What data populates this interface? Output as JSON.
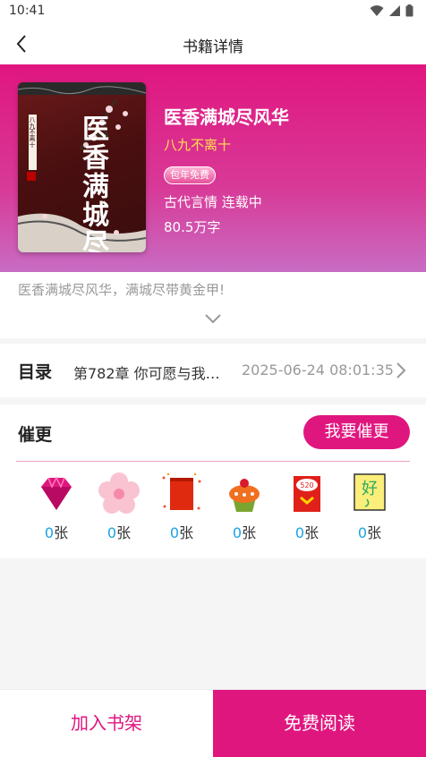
{
  "status_bar": {
    "time": "10:41"
  },
  "nav": {
    "title": "书籍详情"
  },
  "book": {
    "title": "医香满城尽风华",
    "author": "八九不离十",
    "badge": "包年免费",
    "meta": "古代言情 连载中",
    "words": "80.5万字",
    "cover_title_text": "医香满城尽风华",
    "cover_author_text": "八九不离十"
  },
  "intro": {
    "text": "医香满城尽风华，满城尽带黄金甲!"
  },
  "toc": {
    "label": "目录",
    "latest_chapter": "第782章 你可愿与我…",
    "updated": "2025-06-24 08:01:35"
  },
  "urge": {
    "title": "催更",
    "button": "我要催更",
    "unit": "张",
    "gifts": [
      {
        "icon": "diamond-icon",
        "count": "0"
      },
      {
        "icon": "flower-icon",
        "count": "0"
      },
      {
        "icon": "red-envelope-icon",
        "count": "0"
      },
      {
        "icon": "cupcake-icon",
        "count": "0"
      },
      {
        "icon": "520-envelope-icon",
        "count": "0"
      },
      {
        "icon": "good-card-icon",
        "count": "0"
      }
    ]
  },
  "bottom": {
    "add_shelf": "加入书架",
    "read_free": "免费阅读"
  },
  "colors": {
    "accent": "#e0167f",
    "author": "#ffe14d",
    "count": "#1aa3e0"
  }
}
